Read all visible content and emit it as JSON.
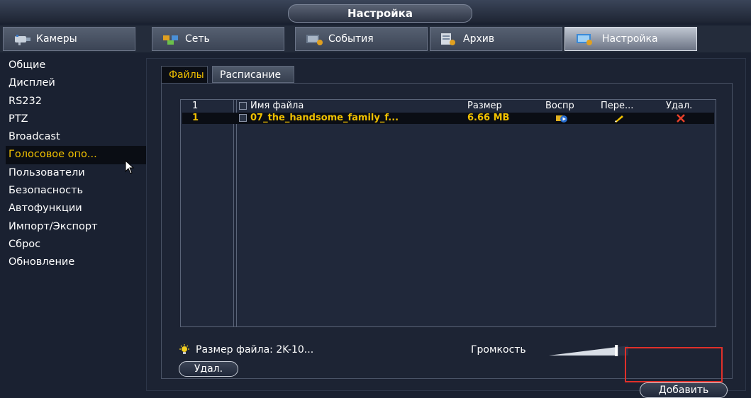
{
  "title": "Настройка",
  "nav": [
    {
      "label": "Камеры",
      "icon": "camera-icon",
      "active": false
    },
    {
      "label": "Сеть",
      "icon": "network-icon",
      "active": false
    },
    {
      "label": "События",
      "icon": "events-icon",
      "active": false
    },
    {
      "label": "Архив",
      "icon": "archive-icon",
      "active": false
    },
    {
      "label": "Настройка",
      "icon": "settings-icon",
      "active": true
    }
  ],
  "sidebar": {
    "items": [
      {
        "label": "Общие"
      },
      {
        "label": "Дисплей"
      },
      {
        "label": "RS232"
      },
      {
        "label": "PTZ"
      },
      {
        "label": "Broadcast"
      },
      {
        "label": "Голосовое опо...",
        "active": true
      },
      {
        "label": "Пользователи"
      },
      {
        "label": "Безопасность"
      },
      {
        "label": "Автофункции"
      },
      {
        "label": "Импорт/Экспорт"
      },
      {
        "label": "Сброс"
      },
      {
        "label": "Обновление"
      }
    ]
  },
  "subtabs": {
    "files": "Файлы",
    "schedule": "Расписание"
  },
  "table": {
    "headers": {
      "num": "1",
      "name": "Имя файла",
      "size": "Размер",
      "play": "Воспр",
      "rename": "Пере...",
      "delete": "Удал."
    },
    "rows": [
      {
        "num": "1",
        "name": "07_the_handsome_family_f...",
        "size": "6.66 MB"
      }
    ]
  },
  "footer": {
    "hint": "Размер файла: 2K-10...",
    "volume_label": "Громкость",
    "volume_level": 0.85,
    "delete_button": "Удал.",
    "add_button": "Добавить"
  },
  "colors": {
    "accent": "#f0c000",
    "highlight": "#e0302a",
    "background": "#1a2131"
  }
}
